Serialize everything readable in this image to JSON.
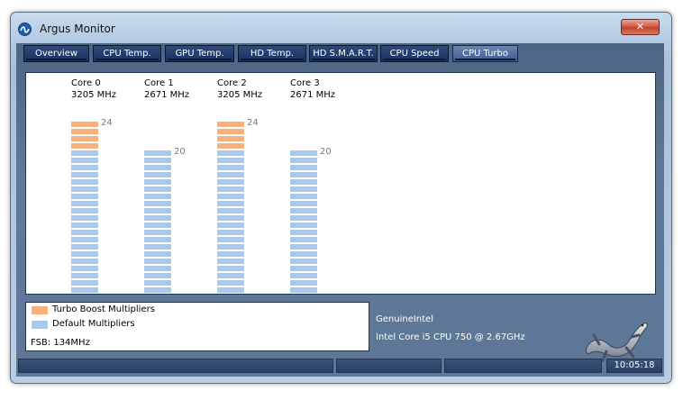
{
  "window": {
    "title": "Argus Monitor",
    "close_glyph": "✕"
  },
  "tabs": [
    {
      "label": "Overview"
    },
    {
      "label": "CPU Temp."
    },
    {
      "label": "GPU Temp."
    },
    {
      "label": "HD Temp."
    },
    {
      "label": "HD S.M.A.R.T."
    },
    {
      "label": "CPU Speed"
    },
    {
      "label": "CPU Turbo",
      "active": true
    }
  ],
  "cores": [
    {
      "name": "Core 0",
      "speed": "3205 MHz",
      "multiplier": 24,
      "value_label": "24"
    },
    {
      "name": "Core 1",
      "speed": "2671 MHz",
      "multiplier": 20,
      "value_label": "20"
    },
    {
      "name": "Core 2",
      "speed": "3205 MHz",
      "multiplier": 24,
      "value_label": "24"
    },
    {
      "name": "Core 3",
      "speed": "2671 MHz",
      "multiplier": 20,
      "value_label": "20"
    }
  ],
  "default_multiplier": 20,
  "legend": {
    "turbo_label": "Turbo Boost Multipliers",
    "default_label": "Default Multipliers",
    "fsb": "FSB: 134MHz"
  },
  "cpu_info": {
    "vendor": "GenuineIntel",
    "model": "Intel Core i5 CPU 750 @ 2.67GHz"
  },
  "status": {
    "clock": "10:05:18"
  },
  "colors": {
    "turbo": "#f9b07d",
    "default": "#a9c8ec",
    "tab_bg": "#1a3160",
    "content_bg": "#5b7390"
  },
  "icons": {
    "app": "argus-app-icon",
    "logo": "gecko-logo"
  }
}
